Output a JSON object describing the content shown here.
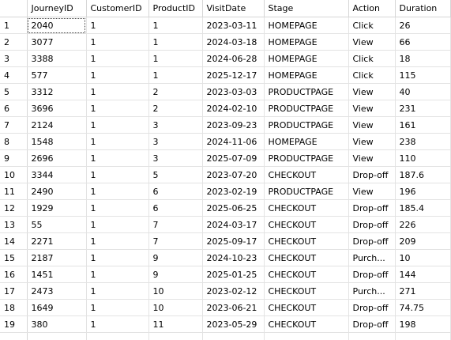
{
  "grid": {
    "columns": [
      "JourneyID",
      "CustomerID",
      "ProductID",
      "VisitDate",
      "Stage",
      "Action",
      "Duration"
    ],
    "rows": [
      [
        "1",
        "2040",
        "1",
        "1",
        "2023-03-11",
        "HOMEPAGE",
        "Click",
        "26"
      ],
      [
        "2",
        "3077",
        "1",
        "1",
        "2024-03-18",
        "HOMEPAGE",
        "View",
        "66"
      ],
      [
        "3",
        "3388",
        "1",
        "1",
        "2024-06-28",
        "HOMEPAGE",
        "Click",
        "18"
      ],
      [
        "4",
        "577",
        "1",
        "1",
        "2025-12-17",
        "HOMEPAGE",
        "Click",
        "115"
      ],
      [
        "5",
        "3312",
        "1",
        "2",
        "2023-03-03",
        "PRODUCTPAGE",
        "View",
        "40"
      ],
      [
        "6",
        "3696",
        "1",
        "2",
        "2024-02-10",
        "PRODUCTPAGE",
        "View",
        "231"
      ],
      [
        "7",
        "2124",
        "1",
        "3",
        "2023-09-23",
        "PRODUCTPAGE",
        "View",
        "161"
      ],
      [
        "8",
        "1548",
        "1",
        "3",
        "2024-11-06",
        "HOMEPAGE",
        "View",
        "238"
      ],
      [
        "9",
        "2696",
        "1",
        "3",
        "2025-07-09",
        "PRODUCTPAGE",
        "View",
        "110"
      ],
      [
        "10",
        "3344",
        "1",
        "5",
        "2023-07-20",
        "CHECKOUT",
        "Drop-off",
        "187.6"
      ],
      [
        "11",
        "2490",
        "1",
        "6",
        "2023-02-19",
        "PRODUCTPAGE",
        "View",
        "196"
      ],
      [
        "12",
        "1929",
        "1",
        "6",
        "2025-06-25",
        "CHECKOUT",
        "Drop-off",
        "185.4"
      ],
      [
        "13",
        "55",
        "1",
        "7",
        "2024-03-17",
        "CHECKOUT",
        "Drop-off",
        "226"
      ],
      [
        "14",
        "2271",
        "1",
        "7",
        "2025-09-17",
        "CHECKOUT",
        "Drop-off",
        "209"
      ],
      [
        "15",
        "2187",
        "1",
        "9",
        "2024-10-23",
        "CHECKOUT",
        "Purch...",
        "10"
      ],
      [
        "16",
        "1451",
        "1",
        "9",
        "2025-01-25",
        "CHECKOUT",
        "Drop-off",
        "144"
      ],
      [
        "17",
        "2473",
        "1",
        "10",
        "2023-02-12",
        "CHECKOUT",
        "Purch...",
        "271"
      ],
      [
        "18",
        "1649",
        "1",
        "10",
        "2023-06-21",
        "CHECKOUT",
        "Drop-off",
        "74.75"
      ],
      [
        "19",
        "380",
        "1",
        "11",
        "2023-05-29",
        "CHECKOUT",
        "Drop-off",
        "198"
      ]
    ],
    "selected": {
      "row": 0,
      "col": 1
    }
  }
}
